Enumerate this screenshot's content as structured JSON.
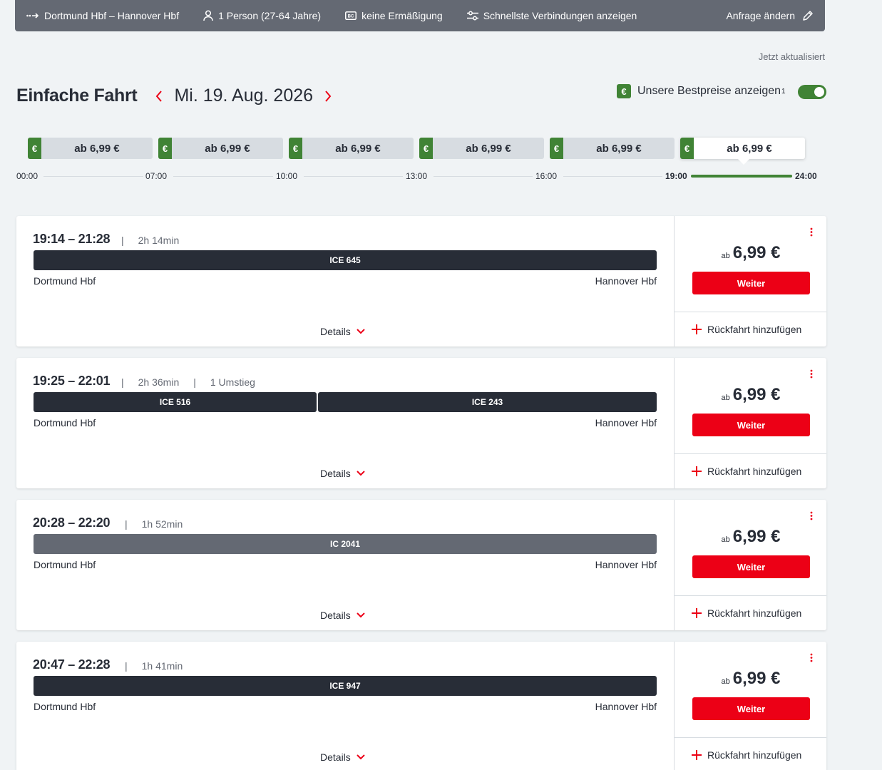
{
  "request": {
    "route": "Dortmund Hbf – Hannover Hbf",
    "passengers": "1 Person (27-64 Jahre)",
    "discount": "keine Ermäßigung",
    "filter": "Schnellste Verbindungen anzeigen",
    "edit": "Anfrage ändern"
  },
  "updated": "Jetzt aktualisiert",
  "title": "Einfache Fahrt",
  "date": "Mi. 19. Aug. 2026",
  "bestprice": {
    "euro": "€",
    "label": "Unsere Bestpreise anzeigen",
    "footnote": "1",
    "enabled": true
  },
  "slots": [
    {
      "price": "ab 6,99 €",
      "active": false
    },
    {
      "price": "ab 6,99 €",
      "active": false
    },
    {
      "price": "ab 6,99 €",
      "active": false
    },
    {
      "price": "ab 6,99 €",
      "active": false
    },
    {
      "price": "ab 6,99 €",
      "active": false
    },
    {
      "price": "ab 6,99 €",
      "active": true
    }
  ],
  "timeline": [
    "00:00",
    "07:00",
    "10:00",
    "13:00",
    "16:00",
    "19:00",
    "24:00"
  ],
  "common": {
    "from": "Dortmund Hbf",
    "to": "Hannover Hbf",
    "details": "Details",
    "ab": "ab",
    "weiter": "Weiter",
    "return": "Rückfahrt hinzufügen"
  },
  "connections": [
    {
      "times": "19:14 – 21:28",
      "duration": "2h 14min",
      "transfers": "",
      "trains": [
        "ICE 645"
      ],
      "price": "6,99 €"
    },
    {
      "times": "19:25 – 22:01",
      "duration": "2h 36min",
      "transfers": "1 Umstieg",
      "trains": [
        "ICE 516",
        "ICE 243"
      ],
      "price": "6,99 €"
    },
    {
      "times": "20:28 – 22:20",
      "duration": "1h 52min",
      "transfers": "",
      "trains": [
        "IC 2041"
      ],
      "price": "6,99 €"
    },
    {
      "times": "20:47 – 22:28",
      "duration": "1h 41min",
      "transfers": "",
      "trains": [
        "ICE 947"
      ],
      "price": "6,99 €"
    }
  ],
  "colors": {
    "accent_red": "#ec0016",
    "best_green": "#408335",
    "train_dark": "#282d37",
    "train_ic": "#646973"
  }
}
